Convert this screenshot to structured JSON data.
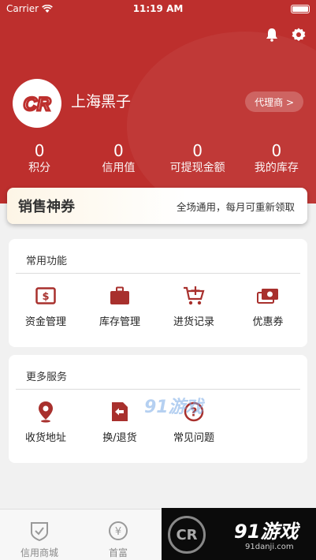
{
  "status_bar": {
    "carrier": "Carrier",
    "time": "11:19 AM"
  },
  "profile": {
    "username": "上海黑子",
    "agent_label": "代理商 >",
    "avatar_text": "CR"
  },
  "stats": [
    {
      "value": "0",
      "label": "积分"
    },
    {
      "value": "0",
      "label": "信用值"
    },
    {
      "value": "0",
      "label": "可提现金额"
    },
    {
      "value": "0",
      "label": "我的库存"
    }
  ],
  "coupon_banner": {
    "title": "销售神券",
    "description": "全场通用，每月可重新领取"
  },
  "common_functions": {
    "title": "常用功能",
    "items": [
      {
        "label": "资金管理",
        "icon": "fund-icon"
      },
      {
        "label": "库存管理",
        "icon": "briefcase-icon"
      },
      {
        "label": "进货记录",
        "icon": "cart-add-icon"
      },
      {
        "label": "优惠券",
        "icon": "coupon-icon"
      }
    ]
  },
  "more_services": {
    "title": "更多服务",
    "items": [
      {
        "label": "收货地址",
        "icon": "location-icon"
      },
      {
        "label": "换/退货",
        "icon": "return-icon"
      },
      {
        "label": "常见问题",
        "icon": "question-icon"
      }
    ]
  },
  "tabbar": [
    {
      "label": "信用商城",
      "icon": "shield-check-icon"
    },
    {
      "label": "首富",
      "icon": "yen-icon"
    }
  ],
  "watermark": {
    "inline_text": "91游戏",
    "brand": "91游戏",
    "url": "91danji.com",
    "corner_logo": "CR"
  },
  "colors": {
    "primary": "#bd2f2d",
    "icon": "#a8302d",
    "background": "#f1f1f1"
  }
}
